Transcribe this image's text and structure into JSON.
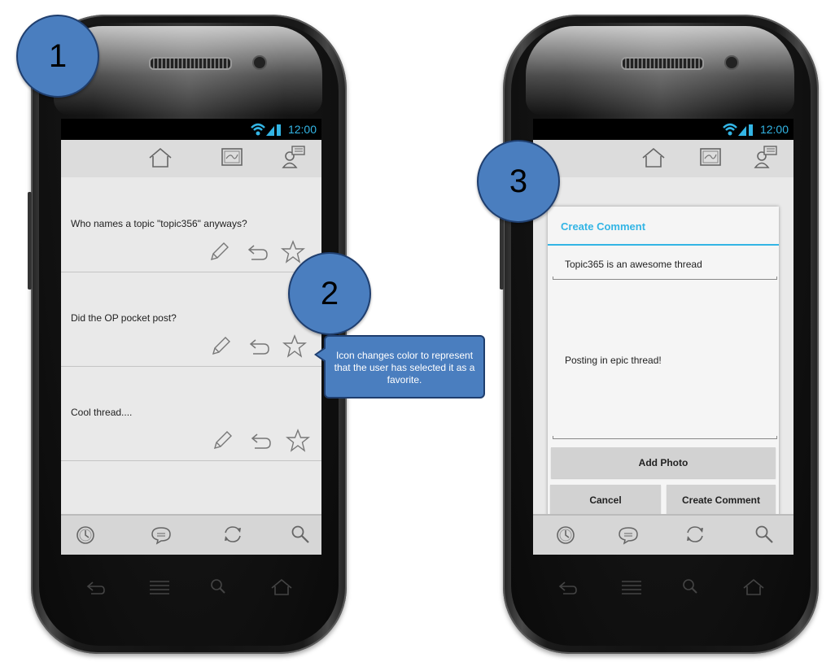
{
  "steps": {
    "one": "1",
    "two": "2",
    "three": "3"
  },
  "status": {
    "time": "12:00"
  },
  "posts": [
    {
      "text": "Who names a topic \"topic356\" anyways?"
    },
    {
      "text": "Did the OP pocket post?"
    },
    {
      "text": "Cool thread...."
    }
  ],
  "callout": {
    "text": "Icon changes color to represent that the user has selected it as a favorite."
  },
  "dialog": {
    "title": "Create Comment",
    "subject_value": "Topic365 is an awesome thread",
    "body_value": "Posting in epic thread!",
    "add_photo_label": "Add Photo",
    "cancel_label": "Cancel",
    "create_label": "Create Comment"
  },
  "colors": {
    "accent": "#33b5e5",
    "badge": "#4a7ebf"
  },
  "icons": {
    "action_bar": [
      "home-icon",
      "map-icon",
      "profile-list-icon"
    ],
    "post_actions": [
      "pencil-icon",
      "reply-icon",
      "star-icon"
    ],
    "bottom_bar": [
      "history-icon",
      "chat-icon",
      "refresh-icon",
      "search-icon"
    ]
  }
}
